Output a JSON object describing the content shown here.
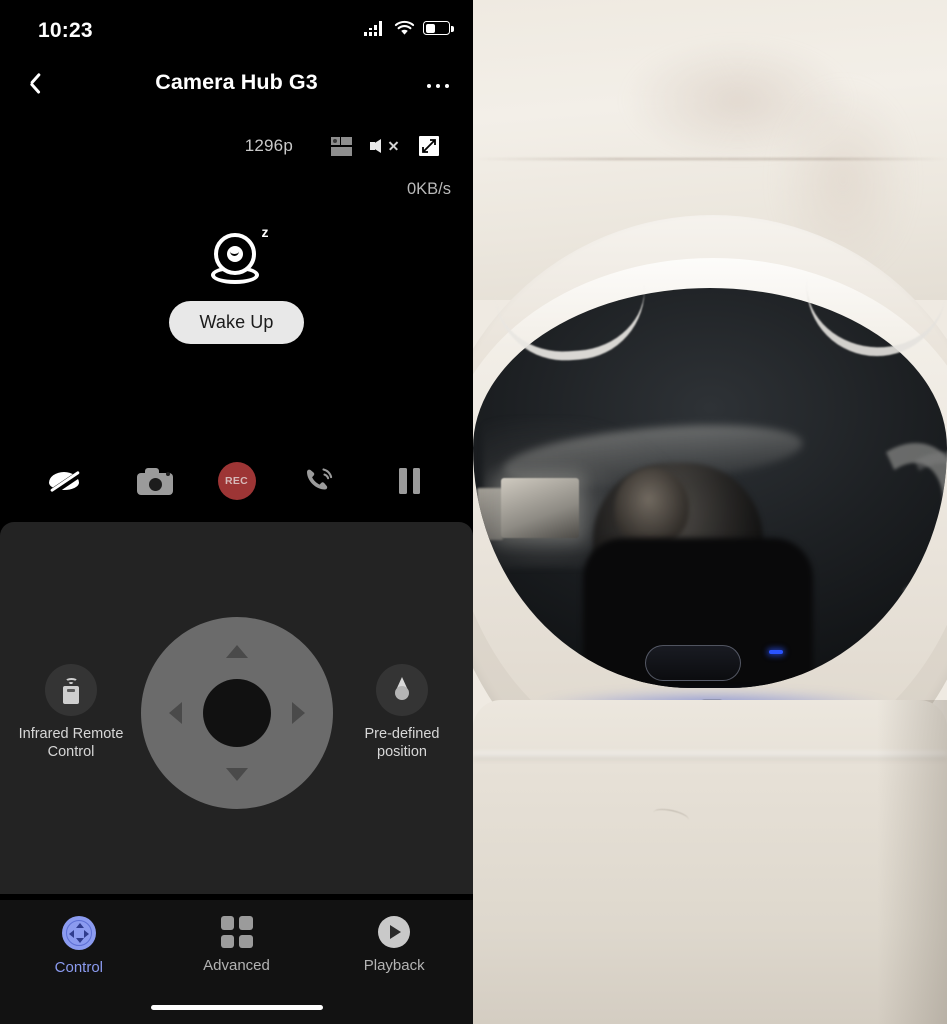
{
  "status_bar": {
    "time": "10:23",
    "icons": [
      "signal-bars-icon",
      "wifi-icon",
      "battery-icon"
    ],
    "battery_level_pct": 38
  },
  "header": {
    "back_icon": "chevron-left-icon",
    "title": "Camera Hub G3",
    "more_icon": "ellipsis-icon"
  },
  "stream_toolbar": {
    "resolution": "1296p",
    "multiview_icon": "multi-view-icon",
    "mute_icon": "speaker-mute-icon",
    "fullscreen_icon": "fullscreen-expand-icon"
  },
  "stream": {
    "bitrate": "0KB/s",
    "sleep_icon": "camera-sleeping-icon",
    "sleep_badge": "z",
    "wake_button": "Wake Up"
  },
  "action_bar": {
    "items": [
      {
        "name": "privacy-eye-off",
        "label": "",
        "icon": "eye-off-icon"
      },
      {
        "name": "snapshot",
        "label": "",
        "icon": "camera-icon"
      },
      {
        "name": "record",
        "label": "REC",
        "icon": "record-icon"
      },
      {
        "name": "two-way-talk",
        "label": "",
        "icon": "phone-call-icon"
      },
      {
        "name": "pause",
        "label": "",
        "icon": "pause-icon"
      }
    ],
    "record_color": "#9d3535",
    "record_label": "REC"
  },
  "ptz_panel": {
    "left_control": {
      "icon": "infrared-remote-icon",
      "label_line1": "Infrared Remote",
      "label_line2": "Control"
    },
    "right_control": {
      "icon": "map-pin-icon",
      "label_line1": "Pre-defined",
      "label_line2": "position"
    },
    "dpad": {
      "up": "arrow-up-icon",
      "down": "arrow-down-icon",
      "left": "arrow-left-icon",
      "right": "arrow-right-icon",
      "center": "dpad-center-button"
    }
  },
  "tab_bar": {
    "active_color": "#8b9bf0",
    "tabs": [
      {
        "label": "Control",
        "icon": "dpad-circle-icon",
        "active": true
      },
      {
        "label": "Advanced",
        "icon": "grid-squares-icon",
        "active": false
      },
      {
        "label": "Playback",
        "icon": "play-circle-icon",
        "active": false
      }
    ]
  },
  "photo": {
    "description": "close-up photo of a white pan-tilt camera with dark glass dome and glowing blue LED ring",
    "led_color": "#1f51f0"
  }
}
